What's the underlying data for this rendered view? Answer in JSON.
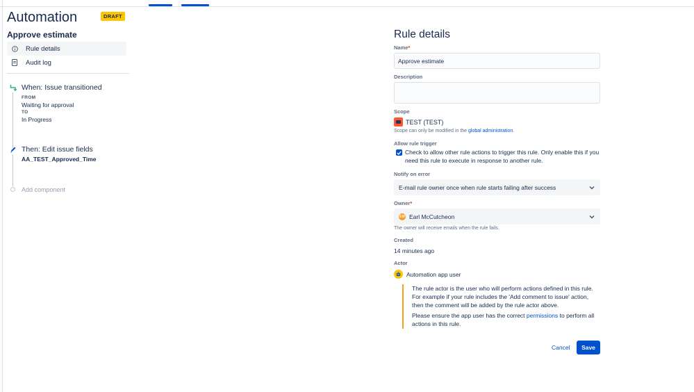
{
  "sidebar": {
    "app_title": "Automation",
    "draft_badge": "DRAFT",
    "rule_name": "Approve estimate",
    "nav": [
      {
        "label": "Rule details",
        "icon": "info-icon",
        "active": true
      },
      {
        "label": "Audit log",
        "icon": "document-icon",
        "active": false
      }
    ],
    "trigger": {
      "title": "When: Issue transitioned",
      "from_label": "FROM",
      "from_value": "Waiting for approval",
      "to_label": "TO",
      "to_value": "In Progress",
      "icon": "trigger-icon"
    },
    "action": {
      "title": "Then: Edit issue fields",
      "field": "AA_TEST_Approved_Time",
      "icon": "pencil-icon"
    },
    "add_component": "Add component"
  },
  "main": {
    "title": "Rule details",
    "name": {
      "label": "Name",
      "value": "Approve estimate"
    },
    "description": {
      "label": "Description",
      "value": ""
    },
    "scope": {
      "label": "Scope",
      "value": "TEST (TEST)",
      "help_prefix": "Scope can only be modified in the ",
      "help_link": "global administration",
      "help_suffix": "."
    },
    "allow_trigger": {
      "label": "Allow rule trigger",
      "checked": true,
      "text": "Check to allow other rule actions to trigger this rule. Only enable this if you need this rule to execute in response to another rule."
    },
    "notify": {
      "label": "Notify on error",
      "value": "E-mail rule owner once when rule starts failing after success"
    },
    "owner": {
      "label": "Owner",
      "value": "Earl McCutcheon",
      "avatar_initials": "EM",
      "help": "The owner will receive emails when the rule fails."
    },
    "created": {
      "label": "Created",
      "value": "14 minutes ago"
    },
    "actor": {
      "label": "Actor",
      "value": "Automation app user",
      "notice_1": "The rule actor is the user who will perform actions defined in this rule. For example if your rule includes the 'Add comment to issue' action, then the comment will be added by the rule actor above.",
      "notice_2_prefix": "Please ensure the app user has the correct ",
      "notice_2_link": "permissions",
      "notice_2_suffix": " to perform all actions in this rule."
    },
    "buttons": {
      "cancel": "Cancel",
      "save": "Save"
    }
  },
  "colors": {
    "primary": "#0052cc",
    "draft_badge": "#ffc400",
    "warning_border": "#ff991f",
    "required": "#de350b"
  }
}
